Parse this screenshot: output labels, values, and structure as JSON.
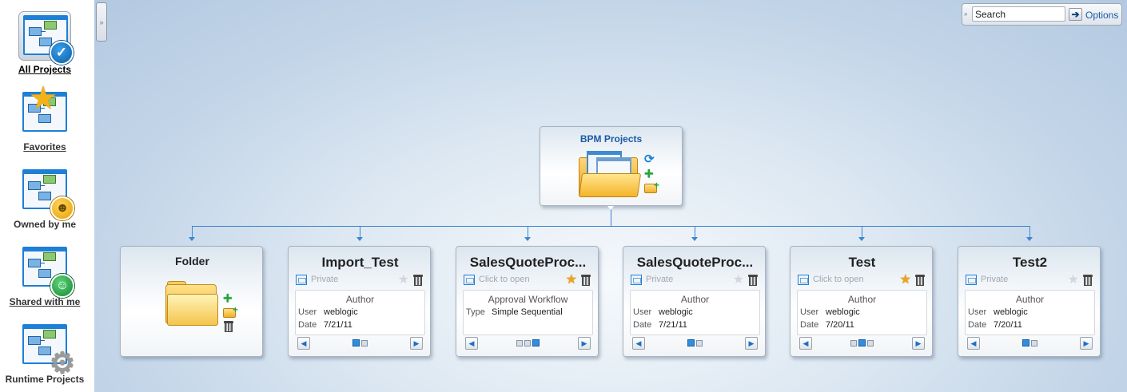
{
  "sidebar": {
    "items": [
      {
        "label": "All Projects",
        "icon": "check-badge-icon",
        "selected": true
      },
      {
        "label": "Favorites",
        "icon": "star-badge-icon"
      },
      {
        "label": "Owned by me",
        "icon": "person-badge-icon"
      },
      {
        "label": "Shared with me",
        "icon": "people-badge-icon"
      },
      {
        "label": "Runtime Projects",
        "icon": "gear-badge-icon"
      }
    ]
  },
  "search": {
    "value": "Search",
    "go_icon": "arrow-right-icon",
    "options_label": "Options"
  },
  "root": {
    "title": "BPM Projects"
  },
  "folder": {
    "title": "Folder"
  },
  "cards": [
    {
      "title": "Import_Test",
      "access": "Private",
      "favorite": false,
      "info_title": "Author",
      "row1_key": "User",
      "row1_value": "weblogic",
      "row2_key": "Date",
      "row2_value": "7/21/11"
    },
    {
      "title": "SalesQuoteProc...",
      "access": "Click to open",
      "favorite": true,
      "info_title": "Approval Workflow",
      "row1_key": "Type",
      "row1_value": "Simple Sequential",
      "row2_key": "",
      "row2_value": ""
    },
    {
      "title": "SalesQuoteProc...",
      "access": "Private",
      "favorite": false,
      "info_title": "Author",
      "row1_key": "User",
      "row1_value": "weblogic",
      "row2_key": "Date",
      "row2_value": "7/21/11"
    },
    {
      "title": "Test",
      "access": "Click to open",
      "favorite": true,
      "info_title": "Author",
      "row1_key": "User",
      "row1_value": "weblogic",
      "row2_key": "Date",
      "row2_value": "7/20/11"
    },
    {
      "title": "Test2",
      "access": "Private",
      "favorite": false,
      "info_title": "Author",
      "row1_key": "User",
      "row1_value": "weblogic",
      "row2_key": "Date",
      "row2_value": "7/20/11"
    }
  ],
  "colors": {
    "accent": "#1e7fd6",
    "title_blue": "#1a5aa6",
    "connector": "#3c86cf",
    "favorite_on": "#f0a417"
  }
}
